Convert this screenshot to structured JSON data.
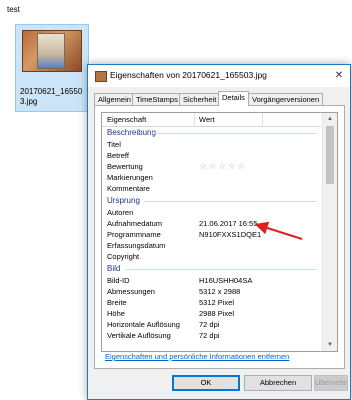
{
  "explorer": {
    "folder_label": "test",
    "file_caption": "20170621_165503.jpg"
  },
  "dialog": {
    "title": "Eigenschaften von 20170621_165503.jpg",
    "close_glyph": "✕",
    "tabs": [
      "Allgemein",
      "TimeStamps",
      "Sicherheit",
      "Details",
      "Vorgängerversionen"
    ],
    "active_tab": "Details",
    "columns": {
      "property": "Eigenschaft",
      "value": "Wert"
    },
    "sections": {
      "beschreibung": "Beschreibung",
      "ursprung": "Ursprung",
      "bild": "Bild"
    },
    "rows": {
      "titel": {
        "k": "Titel",
        "v": ""
      },
      "betreff": {
        "k": "Betreff",
        "v": ""
      },
      "bewertung": {
        "k": "Bewertung",
        "v": "☆☆☆☆☆"
      },
      "markierungen": {
        "k": "Markierungen",
        "v": ""
      },
      "kommentare": {
        "k": "Kommentare",
        "v": ""
      },
      "autoren": {
        "k": "Autoren",
        "v": ""
      },
      "aufnahmedatum": {
        "k": "Aufnahmedatum",
        "v": "21.06.2017 16:55"
      },
      "programmname": {
        "k": "Programmname",
        "v": "N910FXXS1DQE1"
      },
      "erfassungsdatum": {
        "k": "Erfassungsdatum",
        "v": ""
      },
      "copyright": {
        "k": "Copyright",
        "v": ""
      },
      "bild_id": {
        "k": "Bild-ID",
        "v": "H16USHH04SA"
      },
      "abmessungen": {
        "k": "Abmessungen",
        "v": "5312 x 2988"
      },
      "breite": {
        "k": "Breite",
        "v": "5312 Pixel"
      },
      "hoehe": {
        "k": "Höhe",
        "v": "2988 Pixel"
      },
      "horiz_aufl": {
        "k": "Horizontale Auflösung",
        "v": "72 dpi"
      },
      "vert_aufl": {
        "k": "Vertikale Auflösung",
        "v": "72 dpi"
      }
    },
    "link_text": "Eigenschaften und persönliche Informationen entfernen",
    "buttons": {
      "ok": "OK",
      "cancel": "Abbrechen",
      "apply": "Übernehmen"
    },
    "colors": {
      "accent": "#1979ca",
      "section": "#1e3287",
      "arrow": "#e0201e"
    }
  }
}
